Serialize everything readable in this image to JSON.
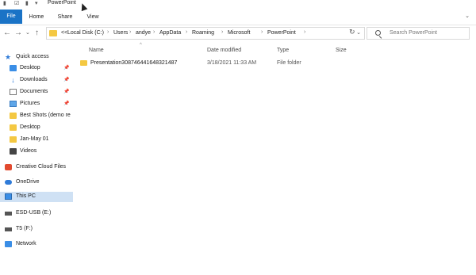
{
  "window": {
    "title": "PowerPoint"
  },
  "ribbon": {
    "tabs": [
      "File",
      "Home",
      "Share",
      "View"
    ]
  },
  "address": {
    "segments": [
      "Local Disk (C:)",
      "Users",
      "andye",
      "AppData",
      "Roaming",
      "Microsoft",
      "PowerPoint"
    ],
    "overflow": "<<"
  },
  "search": {
    "placeholder": "Search PowerPoint"
  },
  "sidebar": {
    "quick_access": "Quick access",
    "items": [
      {
        "label": "Desktop",
        "icon": "desktop-icon",
        "pinned": true
      },
      {
        "label": "Downloads",
        "icon": "downloads-icon",
        "pinned": true
      },
      {
        "label": "Documents",
        "icon": "documents-icon",
        "pinned": true
      },
      {
        "label": "Pictures",
        "icon": "pictures-icon",
        "pinned": true
      },
      {
        "label": "Best Shots (demo re",
        "icon": "folder-icon",
        "pinned": false
      },
      {
        "label": "Desktop",
        "icon": "folder-icon",
        "pinned": false
      },
      {
        "label": "Jan-May 01",
        "icon": "folder-icon",
        "pinned": false
      },
      {
        "label": "Videos",
        "icon": "videos-icon",
        "pinned": false
      }
    ],
    "creative_cloud": "Creative Cloud Files",
    "onedrive": "OneDrive",
    "this_pc": "This PC",
    "drive_esd": "ESD-USB (E:)",
    "drive_t5": "T5 (F:)",
    "network": "Network"
  },
  "columns": {
    "name": "Name",
    "date": "Date modified",
    "type": "Type",
    "size": "Size"
  },
  "files": [
    {
      "name": "Presentation30874644164832148​7",
      "date": "3/18/2021 11:33 AM",
      "type": "File folder",
      "size": ""
    }
  ],
  "colors": {
    "accent": "#1a73c6",
    "folder": "#f4c842",
    "selection": "#cfe1f4"
  }
}
